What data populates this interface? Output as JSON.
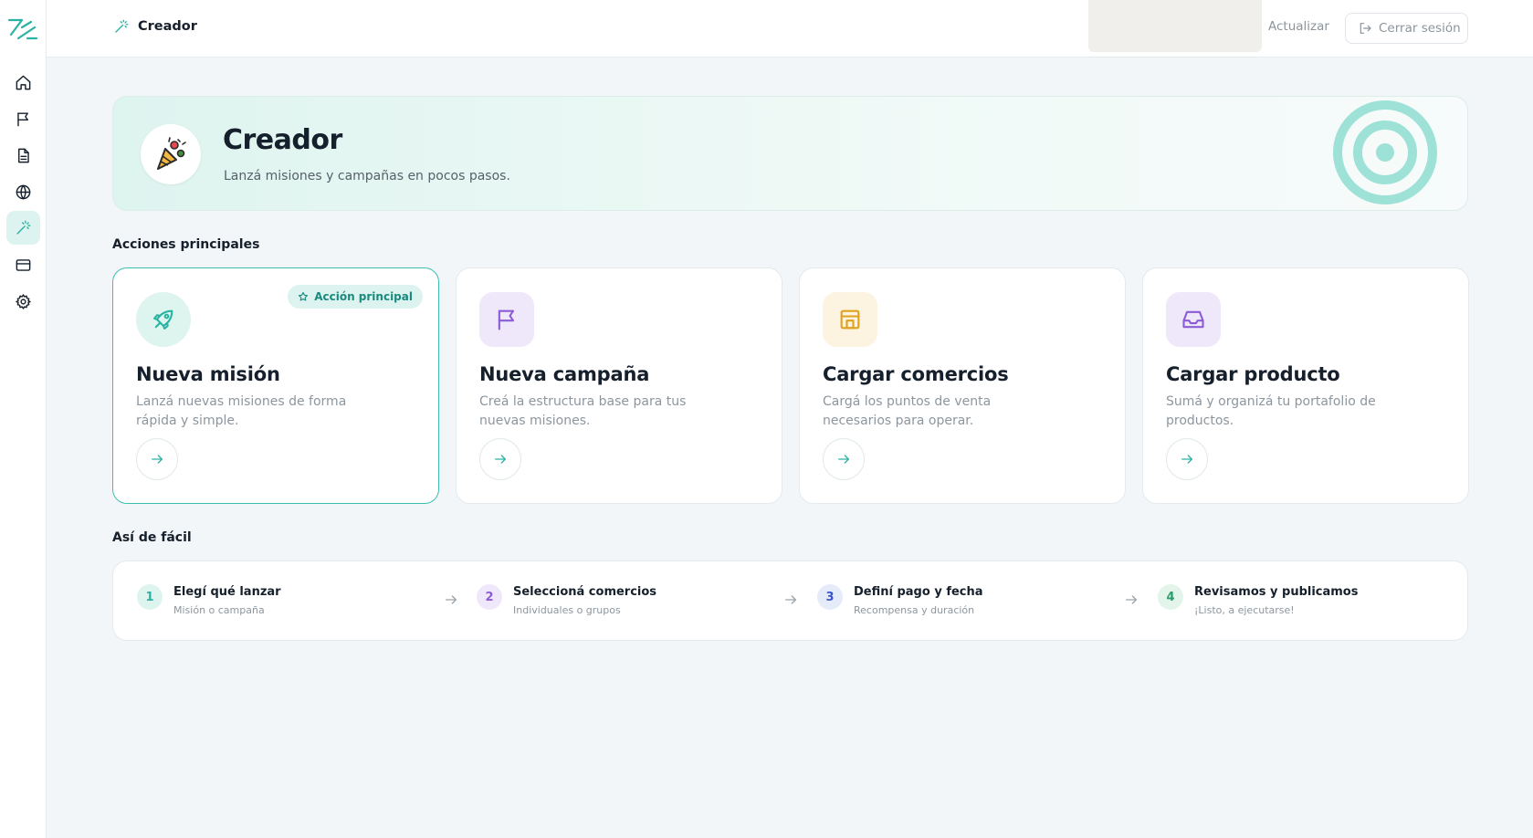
{
  "sidebar": {
    "items": [
      {
        "name": "home-icon",
        "active": false
      },
      {
        "name": "flag-icon",
        "active": false
      },
      {
        "name": "document-icon",
        "active": false
      },
      {
        "name": "globe-icon",
        "active": false
      },
      {
        "name": "magic-wand-icon",
        "active": true
      },
      {
        "name": "credit-card-icon",
        "active": false
      },
      {
        "name": "gear-icon",
        "active": false
      }
    ]
  },
  "header": {
    "title": "Creador",
    "refresh_label": "Actualizar",
    "logout_label": "Cerrar sesión"
  },
  "hero": {
    "title": "Creador",
    "subtitle": "Lanzá misiones y campañas en pocos pasos."
  },
  "actions": {
    "section_title": "Acciones principales",
    "badge": "Acción principal",
    "cards": [
      {
        "title": "Nueva misión",
        "description": "Lanzá nuevas misiones de forma rápida y simple.",
        "icon": "rocket-icon",
        "color": "#2ab3a3"
      },
      {
        "title": "Nueva campaña",
        "description": "Creá la estructura base para tus nuevas misiones.",
        "icon": "flag-icon",
        "color": "#8b5cd6"
      },
      {
        "title": "Cargar comercios",
        "description": "Cargá los puntos de venta necesarios para operar.",
        "icon": "store-icon",
        "color": "#e0a11c"
      },
      {
        "title": "Cargar producto",
        "description": "Sumá y organizá tu portafolio de productos.",
        "icon": "inbox-icon",
        "color": "#8b5cd6"
      }
    ]
  },
  "steps": {
    "section_title": "Así de fácil",
    "items": [
      {
        "number": "1",
        "title": "Elegí qué lanzar",
        "subtitle": "Misión o campaña"
      },
      {
        "number": "2",
        "title": "Seleccioná comercios",
        "subtitle": "Individuales o grupos"
      },
      {
        "number": "3",
        "title": "Definí pago y fecha",
        "subtitle": "Recompensa y duración"
      },
      {
        "number": "4",
        "title": "Revisamos y publicamos",
        "subtitle": "¡Listo, a ejecutarse!"
      }
    ]
  },
  "colors": {
    "accent": "#2ab3a3",
    "purple": "#8b5cd6",
    "amber": "#e0a11c",
    "blue": "#3b55c9",
    "green": "#2a9d6b"
  }
}
